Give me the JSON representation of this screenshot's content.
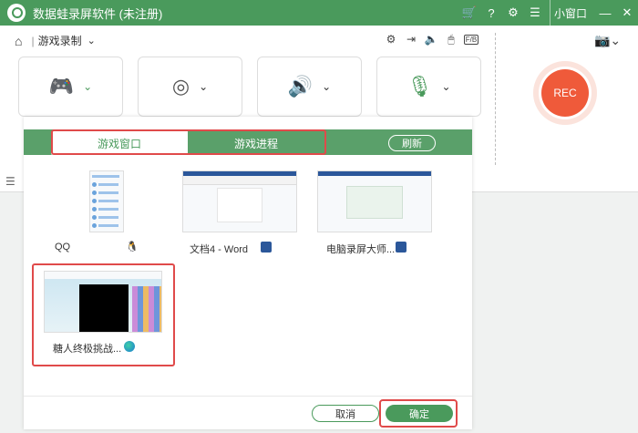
{
  "app": {
    "title": "数据蛙录屏软件 (未注册)",
    "mini_window_label": "小窗口"
  },
  "toolbar": {
    "mode_label": "游戏录制"
  },
  "record": {
    "rec_label": "REC"
  },
  "dialog": {
    "tabs": [
      {
        "label": "游戏窗口",
        "active": true
      },
      {
        "label": "游戏进程",
        "active": false
      }
    ],
    "refresh_label": "刷新",
    "windows": [
      {
        "caption": "QQ",
        "app_icon": "qq-penguin-icon"
      },
      {
        "caption": "文档4 - Word",
        "app_icon": "word-icon"
      },
      {
        "caption": "电脑录屏大师...",
        "app_icon": "word-icon"
      },
      {
        "caption": "糖人终极挑战...",
        "app_icon": "edge-icon",
        "selected": true
      }
    ],
    "cancel_label": "取消",
    "ok_label": "确定"
  },
  "colors": {
    "accent": "#4a9a5c",
    "highlight": "#e04a4a",
    "rec": "#ef5a3a"
  }
}
